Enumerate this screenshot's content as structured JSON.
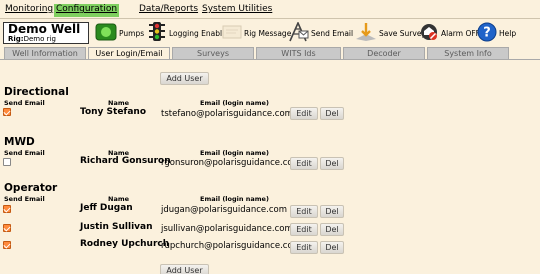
{
  "menu": {
    "items": [
      {
        "label": "Monitoring"
      },
      {
        "label": "Configuration"
      },
      {
        "label": "Data/Reports"
      },
      {
        "label": "System Utilities"
      }
    ]
  },
  "toolbar": {
    "well_name": "Demo Well",
    "rig_label": "Rig:",
    "rig_value": "Demo rig",
    "pumps": "Pumps",
    "logging": "Logging Enable",
    "rig_message": "Rig Message",
    "send_email": "Send Email",
    "save_survey": "Save Survey",
    "alarm": "Alarm OFF",
    "help": "Help"
  },
  "tabs": [
    {
      "label": "Well Information"
    },
    {
      "label": "User Login/Email"
    },
    {
      "label": "Surveys"
    },
    {
      "label": "WITS Ids"
    },
    {
      "label": "Decoder"
    },
    {
      "label": "System Info"
    }
  ],
  "add_user_label": "Add User",
  "columns": {
    "send_email": "Send Email",
    "name": "Name",
    "email": "Email (login name)"
  },
  "row_buttons": {
    "edit": "Edit",
    "del": "Del"
  },
  "sections": [
    {
      "title": "Directional",
      "users": [
        {
          "send_email": true,
          "name": "Tony Stefano",
          "email": "tstefano@polarisguidance.com"
        }
      ]
    },
    {
      "title": "MWD",
      "users": [
        {
          "send_email": false,
          "name": "Richard Gonsuron",
          "email": "rgonsuron@polarisguidance.com"
        }
      ]
    },
    {
      "title": "Operator",
      "users": [
        {
          "send_email": true,
          "name": "Jeff Dugan",
          "email": "jdugan@polarisguidance.com"
        },
        {
          "send_email": true,
          "name": "Justin Sullivan",
          "email": "jsullivan@polarisguidance.com"
        },
        {
          "send_email": true,
          "name": "Rodney Upchurch",
          "email": "rupchurch@polarisguidance.com"
        }
      ]
    }
  ],
  "colors": {
    "background": "#fbf1dd",
    "active_menu": "#7fcf5f",
    "checkbox_on": "#ff8a3c",
    "tab_inactive": "#c9c9c9"
  },
  "icons": [
    "pumps-icon",
    "traffic-light-icon",
    "rig-message-icon",
    "send-email-icon",
    "save-survey-icon",
    "alarm-off-icon",
    "help-icon"
  ]
}
